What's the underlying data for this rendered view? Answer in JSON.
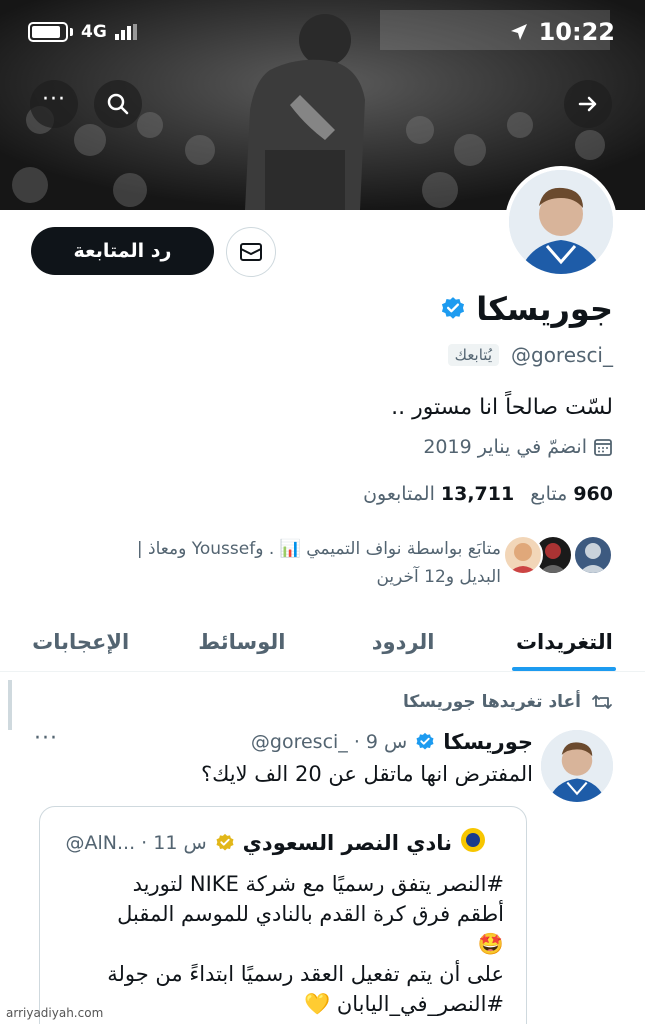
{
  "status_bar": {
    "network": "4G",
    "time": "10:22"
  },
  "header": {
    "more_icon": "more-icon",
    "search_icon": "search-icon",
    "forward_icon": "forward-arrow-icon"
  },
  "profile": {
    "follow_back_label": "رد المتابعة",
    "name": "جوريسكا",
    "handle": "@goresci_",
    "follows_you": "يُتابعك",
    "bio": "لسّت صالحاً انا مستور ..",
    "joined": "انضمّ في يناير 2019",
    "following_count": "960",
    "following_label": "متابع",
    "followers_count": "13,711",
    "followers_label": "المتابعون",
    "followed_by_line1": "متابَع بواسطة نواف التميمي 📊 . وYoussef ومعاذ |",
    "followed_by_line2": "البديل و12 آخرين"
  },
  "tabs": [
    {
      "label": "التغريدات",
      "active": true
    },
    {
      "label": "الردود",
      "active": false
    },
    {
      "label": "الوسائط",
      "active": false
    },
    {
      "label": "الإعجابات",
      "active": false
    }
  ],
  "tweet": {
    "retweeted_by": "أعاد تغريدها جوريسكا",
    "author_name": "جوريسكا",
    "author_handle_time": "@goresci_ · 9 س",
    "more": "···",
    "text": "المفترض انها ماتقل عن 20 الف لايك؟"
  },
  "quote": {
    "author_name": "نادي النصر السعودي",
    "handle_time": "@AlN... · 11 س",
    "line1": "#النصر يتفق رسميًا مع شركة NIKE لتوريد",
    "line2": "أطقم فرق كرة القدم بالنادي للموسم المقبل",
    "line3": "🤩",
    "line4": "على أن يتم تفعيل العقد رسميًا ابتداءً من جولة",
    "line5": "#النصر_في_اليابان 💛"
  },
  "watermark": "arriyadiyah.com",
  "colors": {
    "accent": "#1d9bf0",
    "verified": "#1d9bf0",
    "gold_verified": "#e2b719",
    "button_dark": "#0f1419"
  }
}
